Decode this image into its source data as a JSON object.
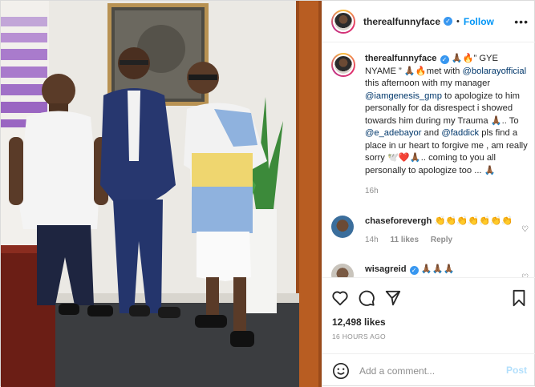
{
  "header": {
    "username": "therealfunnyface",
    "follow_label": "Follow",
    "dot": "•",
    "more_icon": "more-options-icon"
  },
  "caption": {
    "username": "therealfunnyface",
    "text_1": " 🙏🏾🔥” GYE NYAME ” 🙏🏾🔥met with ",
    "mention_1": "@bolarayofficial",
    "text_2": " this afternoon with my manager ",
    "mention_2": "@iamgenesis_gmp",
    "text_3": " to apologize to him personally for da disrespect i showed towards him during my Trauma 🙏🏾.. To ",
    "mention_3": "@e_adebayor",
    "text_4": " and ",
    "mention_4": "@faddick",
    "text_5": " pls find a place in ur heart to forgive me , am really sorry 🕊️❤️🙏🏾.. coming to you all personally to apologize too ... 🙏🏾",
    "time": "16h"
  },
  "comments": [
    {
      "username": "chaseforevergh",
      "text": "👏👏👏👏👏👏👏",
      "time": "14h",
      "likes": "11 likes",
      "reply": "Reply"
    },
    {
      "username": "wisagreid",
      "text": "🙏🏾🙏🏾🙏🏾"
    }
  ],
  "likes": "12,498 likes",
  "posted_ago": "16 HOURS AGO",
  "add_comment": {
    "placeholder": "Add a comment...",
    "post_label": "Post"
  },
  "colors": {
    "accent": "#0095f6",
    "verified": "#3897f0",
    "post_disabled": "#b2dffc"
  }
}
